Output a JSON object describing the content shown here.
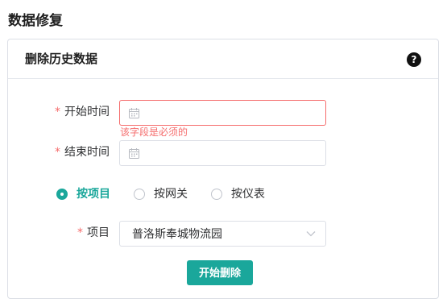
{
  "page": {
    "title": "数据修复"
  },
  "card": {
    "title": "删除历史数据",
    "help_icon": "question-circle-icon"
  },
  "form": {
    "required_mark": "*",
    "start_time": {
      "label": "开始时间",
      "value": "",
      "error": "该字段是必须的",
      "icon": "calendar-icon"
    },
    "end_time": {
      "label": "结束时间",
      "value": "",
      "icon": "calendar-icon"
    },
    "mode_options": [
      {
        "label": "按项目",
        "checked": true
      },
      {
        "label": "按网关",
        "checked": false
      },
      {
        "label": "按仪表",
        "checked": false
      }
    ],
    "project": {
      "label": "项目",
      "value": "普洛斯奉城物流园",
      "icon": "chevron-down-icon"
    },
    "submit_label": "开始删除"
  },
  "colors": {
    "accent": "#1aa79b",
    "error": "#f56c6c"
  }
}
